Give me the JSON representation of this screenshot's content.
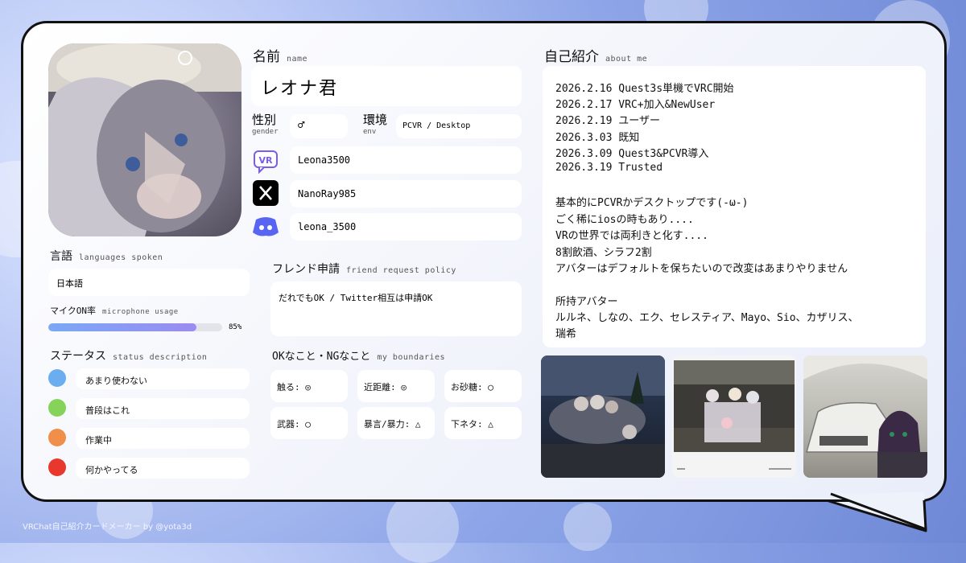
{
  "name": {
    "label": "名前",
    "sub": "name",
    "value": "レオナ君"
  },
  "gender": {
    "label": "性別",
    "sub": "gender",
    "value": "♂"
  },
  "env": {
    "label": "環境",
    "sub": "env",
    "value": "PCVR / Desktop"
  },
  "accounts": [
    {
      "icon": "vrchat-icon",
      "value": "Leona3500"
    },
    {
      "icon": "x-icon",
      "value": "NanoRay985"
    },
    {
      "icon": "discord-icon",
      "value": "leona_3500"
    }
  ],
  "languages": {
    "label": "言語",
    "sub": "languages spoken",
    "value": "日本語"
  },
  "mic": {
    "label": "マイクON率",
    "sub": "microphone usage",
    "value": "85%",
    "fraction": 0.85
  },
  "status": {
    "label": "ステータス",
    "sub": "status description",
    "items": [
      {
        "color": "#6aaef0",
        "text": "あまり使わない"
      },
      {
        "color": "#86d35c",
        "text": "普段はこれ"
      },
      {
        "color": "#f08f4a",
        "text": "作業中"
      },
      {
        "color": "#e8382e",
        "text": "何かやってる"
      }
    ]
  },
  "friend": {
    "label": "フレンド申請",
    "sub": "friend request policy",
    "value": "だれでもOK / Twitter相互は申請OK"
  },
  "boundaries": {
    "label": "OKなこと・NGなこと",
    "sub": "my boundaries",
    "items": [
      "触る: ◎",
      "近距離: ◎",
      "お砂糖: ◯",
      "武器: ◯",
      "暴言/暴力: △",
      "下ネタ: △"
    ]
  },
  "about": {
    "label": "自己紹介",
    "sub": "about me",
    "lines": [
      "2026.2.16 Quest3s単機でVRC開始",
      "2026.2.17 VRC+加入&NewUser",
      "2026.2.19 ユーザー",
      "2026.3.03 既知",
      "2026.3.09 Quest3&PCVR導入",
      "2026.3.19 Trusted",
      "",
      "基本的にPCVRかデスクトップです(-ω-)",
      "ごく稀にiosの時もあり....",
      "VRの世界では両利きと化す....",
      "8割飲酒、シラフ2割",
      "アバターはデフォルトを保ちたいので改変はあまりやりません",
      "",
      "所持アバター",
      "ルルネ、しなの、エク、セレスティア、Mayo、Sio、カザリス、",
      "瑞希"
    ]
  },
  "footer": "VRChat自己紹介カードメーカー by @yota3d"
}
